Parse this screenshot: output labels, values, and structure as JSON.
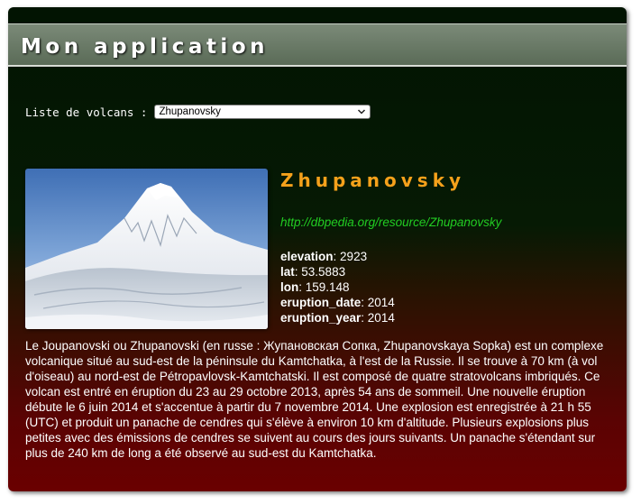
{
  "app": {
    "title": "Mon application"
  },
  "selector": {
    "label": "Liste de volcans :",
    "selected": "Zhupanovsky"
  },
  "volcano": {
    "name": "Zhupanovsky",
    "resource_url": "http://dbpedia.org/resource/Zhupanovsky",
    "properties": [
      {
        "key": "elevation",
        "value": "2923"
      },
      {
        "key": "lat",
        "value": "53.5883"
      },
      {
        "key": "lon",
        "value": "159.148"
      },
      {
        "key": "eruption_date",
        "value": "2014"
      },
      {
        "key": "eruption_year",
        "value": "2014"
      }
    ],
    "description": "Le Joupanovski ou Zhupanovski (en russe : Жупановская Сопка, Zhupanovskaya Sopka) est un complexe volcanique situé au sud-est de la péninsule du Kamtchatka, à l'est de la Russie. Il se trouve à 70 km (à vol d'oiseau) au nord-est de Pétropavlovsk-Kamtchatski. Il est composé de quatre stratovolcans imbriqués. Ce volcan est entré en éruption du 23 au 29 octobre 2013, après 54 ans de sommeil. Une nouvelle éruption débute le 6 juin 2014 et s'accentue à partir du 7 novembre 2014. Une explosion est enregistrée à 21 h 55 (UTC) et produit un panache de cendres qui s'élève à environ 10 km d'altitude. Plusieurs explosions plus petites avec des émissions de cendres se suivent au cours des jours suivants. Un panache s'étendant sur plus de 240 km de long a été observé au sud-est du Kamtchatka."
  },
  "colors": {
    "title_accent": "#f5a11b",
    "link": "#22cc22",
    "panel_top": "#021402",
    "panel_bottom": "#6a0000"
  }
}
